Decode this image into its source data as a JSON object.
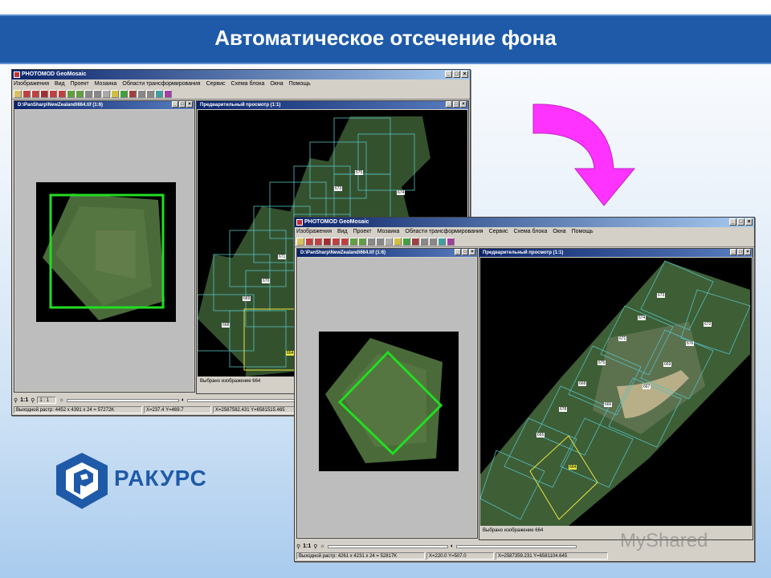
{
  "slide": {
    "title": "Автоматическое отсечение фона",
    "logo_text": "РАКУРС",
    "watermark": "MyShared"
  },
  "app": {
    "window_title": "PHOTOMOD GeoMosaic",
    "menu": [
      "Изображения",
      "Вид",
      "Проект",
      "Мозаика",
      "Области трансформирования",
      "Сервис",
      "Схема блока",
      "Окна",
      "Помощь"
    ]
  },
  "window1": {
    "left_pane_title": "D:\\PanSharp\\NewZealand\\664.tif (1:6)",
    "preview_title": "Предварительный просмотр (1:1)",
    "selected_text": "Выбрано изображение 664",
    "zoom_value": "1 : 1",
    "status_raster": "Выходной растр: 4452 x 4391 x 24 = 57272K",
    "status_xy": "X=237.4 Y=469.7",
    "status_geo": "X=2587582.431 Y=6581515.465"
  },
  "window2": {
    "left_pane_title": "D:\\PanSharp\\NewZealand\\664.tif (1:6)",
    "preview_title": "Предварительный просмотр (1:1)",
    "selected_text": "Выбрано изображение 664",
    "status_raster": "Выходной растр: 4261 x 4231 x 24 = 52817K",
    "status_xy": "X=220.0 Y=507.0",
    "status_geo": "X=2587359.231 Y=6581104.645"
  },
  "tile_labels": {
    "w1": [
      "675",
      "674",
      "673",
      "672",
      "671",
      "670",
      "669",
      "668",
      "667",
      "666",
      "665",
      "664"
    ],
    "w2": [
      "673",
      "674",
      "672",
      "671",
      "676",
      "675",
      "669",
      "668",
      "667",
      "678",
      "666",
      "665",
      "664"
    ]
  },
  "colors": {
    "title_band": "#1e5aa8",
    "arrow": "#ff33ff",
    "selection_green": "#22dd22",
    "tile_grid": "#55c0c0",
    "selected_tile": "#e8e840"
  },
  "icons": [
    "curved-down-arrow-icon",
    "rakurs-logo-icon",
    "zoom-icon",
    "sun-icon",
    "contrast-icon",
    "close-icon",
    "minimize-icon",
    "maximize-icon"
  ]
}
